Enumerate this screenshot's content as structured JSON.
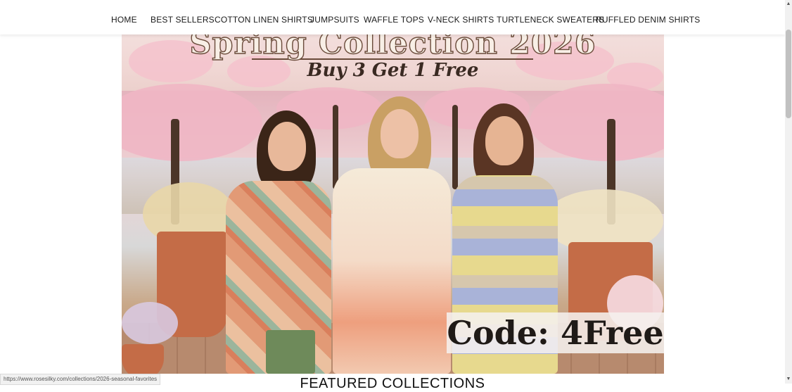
{
  "nav": {
    "items": [
      "HOME",
      "BEST SELLERS",
      "COTTON LINEN SHIRTS",
      "JUMPSUITS",
      "WAFFLE TOPS",
      "V-NECK SHIRTS",
      "TURTLENECK SWEATERS",
      "RUFFLED DENIM SHIRTS"
    ]
  },
  "hero": {
    "title": "Spring Collection 2026",
    "subtitle": "Buy 3 Get 1 Free",
    "code": "Code: 4Free"
  },
  "status_url": "https://www.rosesilky.com/collections/2026-seasonal-favorites",
  "featured_heading": "FEATURED COLLECTIONS",
  "colors": {
    "nav_text": "#1a1a1a",
    "hero_title_fill": "#f8efe6",
    "hero_title_stroke": "#6a4b3a",
    "code_text": "#1f1a17"
  }
}
